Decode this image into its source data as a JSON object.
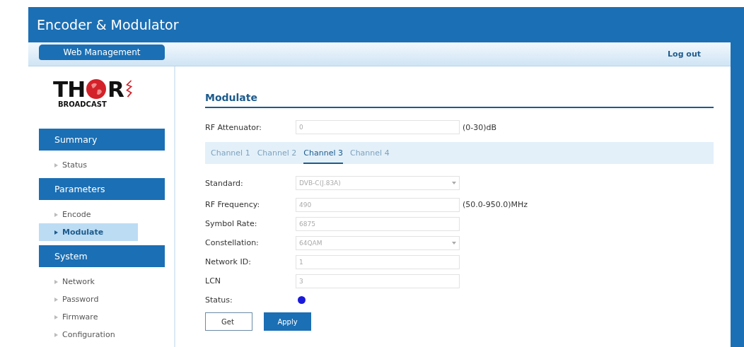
{
  "window": {
    "title": "Encoder & Modulator"
  },
  "nav": {
    "tab": "Web Management",
    "logout": "Log out"
  },
  "logo": {
    "left": "TH",
    "right": "R",
    "subtitle": "BROADCAST"
  },
  "sidebar": [
    {
      "title": "Summary",
      "items": [
        {
          "label": "Status",
          "selected": false
        }
      ]
    },
    {
      "title": "Parameters",
      "items": [
        {
          "label": "Encode",
          "selected": false
        },
        {
          "label": "Modulate",
          "selected": true
        }
      ]
    },
    {
      "title": "System",
      "items": [
        {
          "label": "Network",
          "selected": false
        },
        {
          "label": "Password",
          "selected": false
        },
        {
          "label": "Firmware",
          "selected": false
        },
        {
          "label": "Configuration",
          "selected": false
        }
      ]
    }
  ],
  "content": {
    "heading": "Modulate",
    "attenuator": {
      "label": "RF Attenuator:",
      "value": "0",
      "unit": "(0-30)dB"
    },
    "tabs": [
      {
        "label": "Channel 1",
        "selected": false
      },
      {
        "label": "Channel 2",
        "selected": false
      },
      {
        "label": "Channel 3",
        "selected": true
      },
      {
        "label": "Channel 4",
        "selected": false
      }
    ],
    "fields": [
      {
        "kind": "select",
        "label": "Standard:",
        "value": "DVB-C(J.83A)"
      },
      {
        "kind": "input",
        "label": "RF Frequency:",
        "value": "490",
        "unit": "(50.0-950.0)MHz"
      },
      {
        "kind": "input",
        "label": "Symbol Rate:",
        "value": "6875"
      },
      {
        "kind": "select",
        "label": "Constellation:",
        "value": "64QAM"
      },
      {
        "kind": "input",
        "label": "Network ID:",
        "value": "1"
      },
      {
        "kind": "input",
        "label": "LCN",
        "value": "3"
      },
      {
        "kind": "status",
        "label": "Status:",
        "color": "#1a1adb"
      }
    ],
    "buttons": [
      {
        "label": "Get",
        "kind": "secondary"
      },
      {
        "label": "Apply",
        "kind": "primary"
      }
    ]
  }
}
